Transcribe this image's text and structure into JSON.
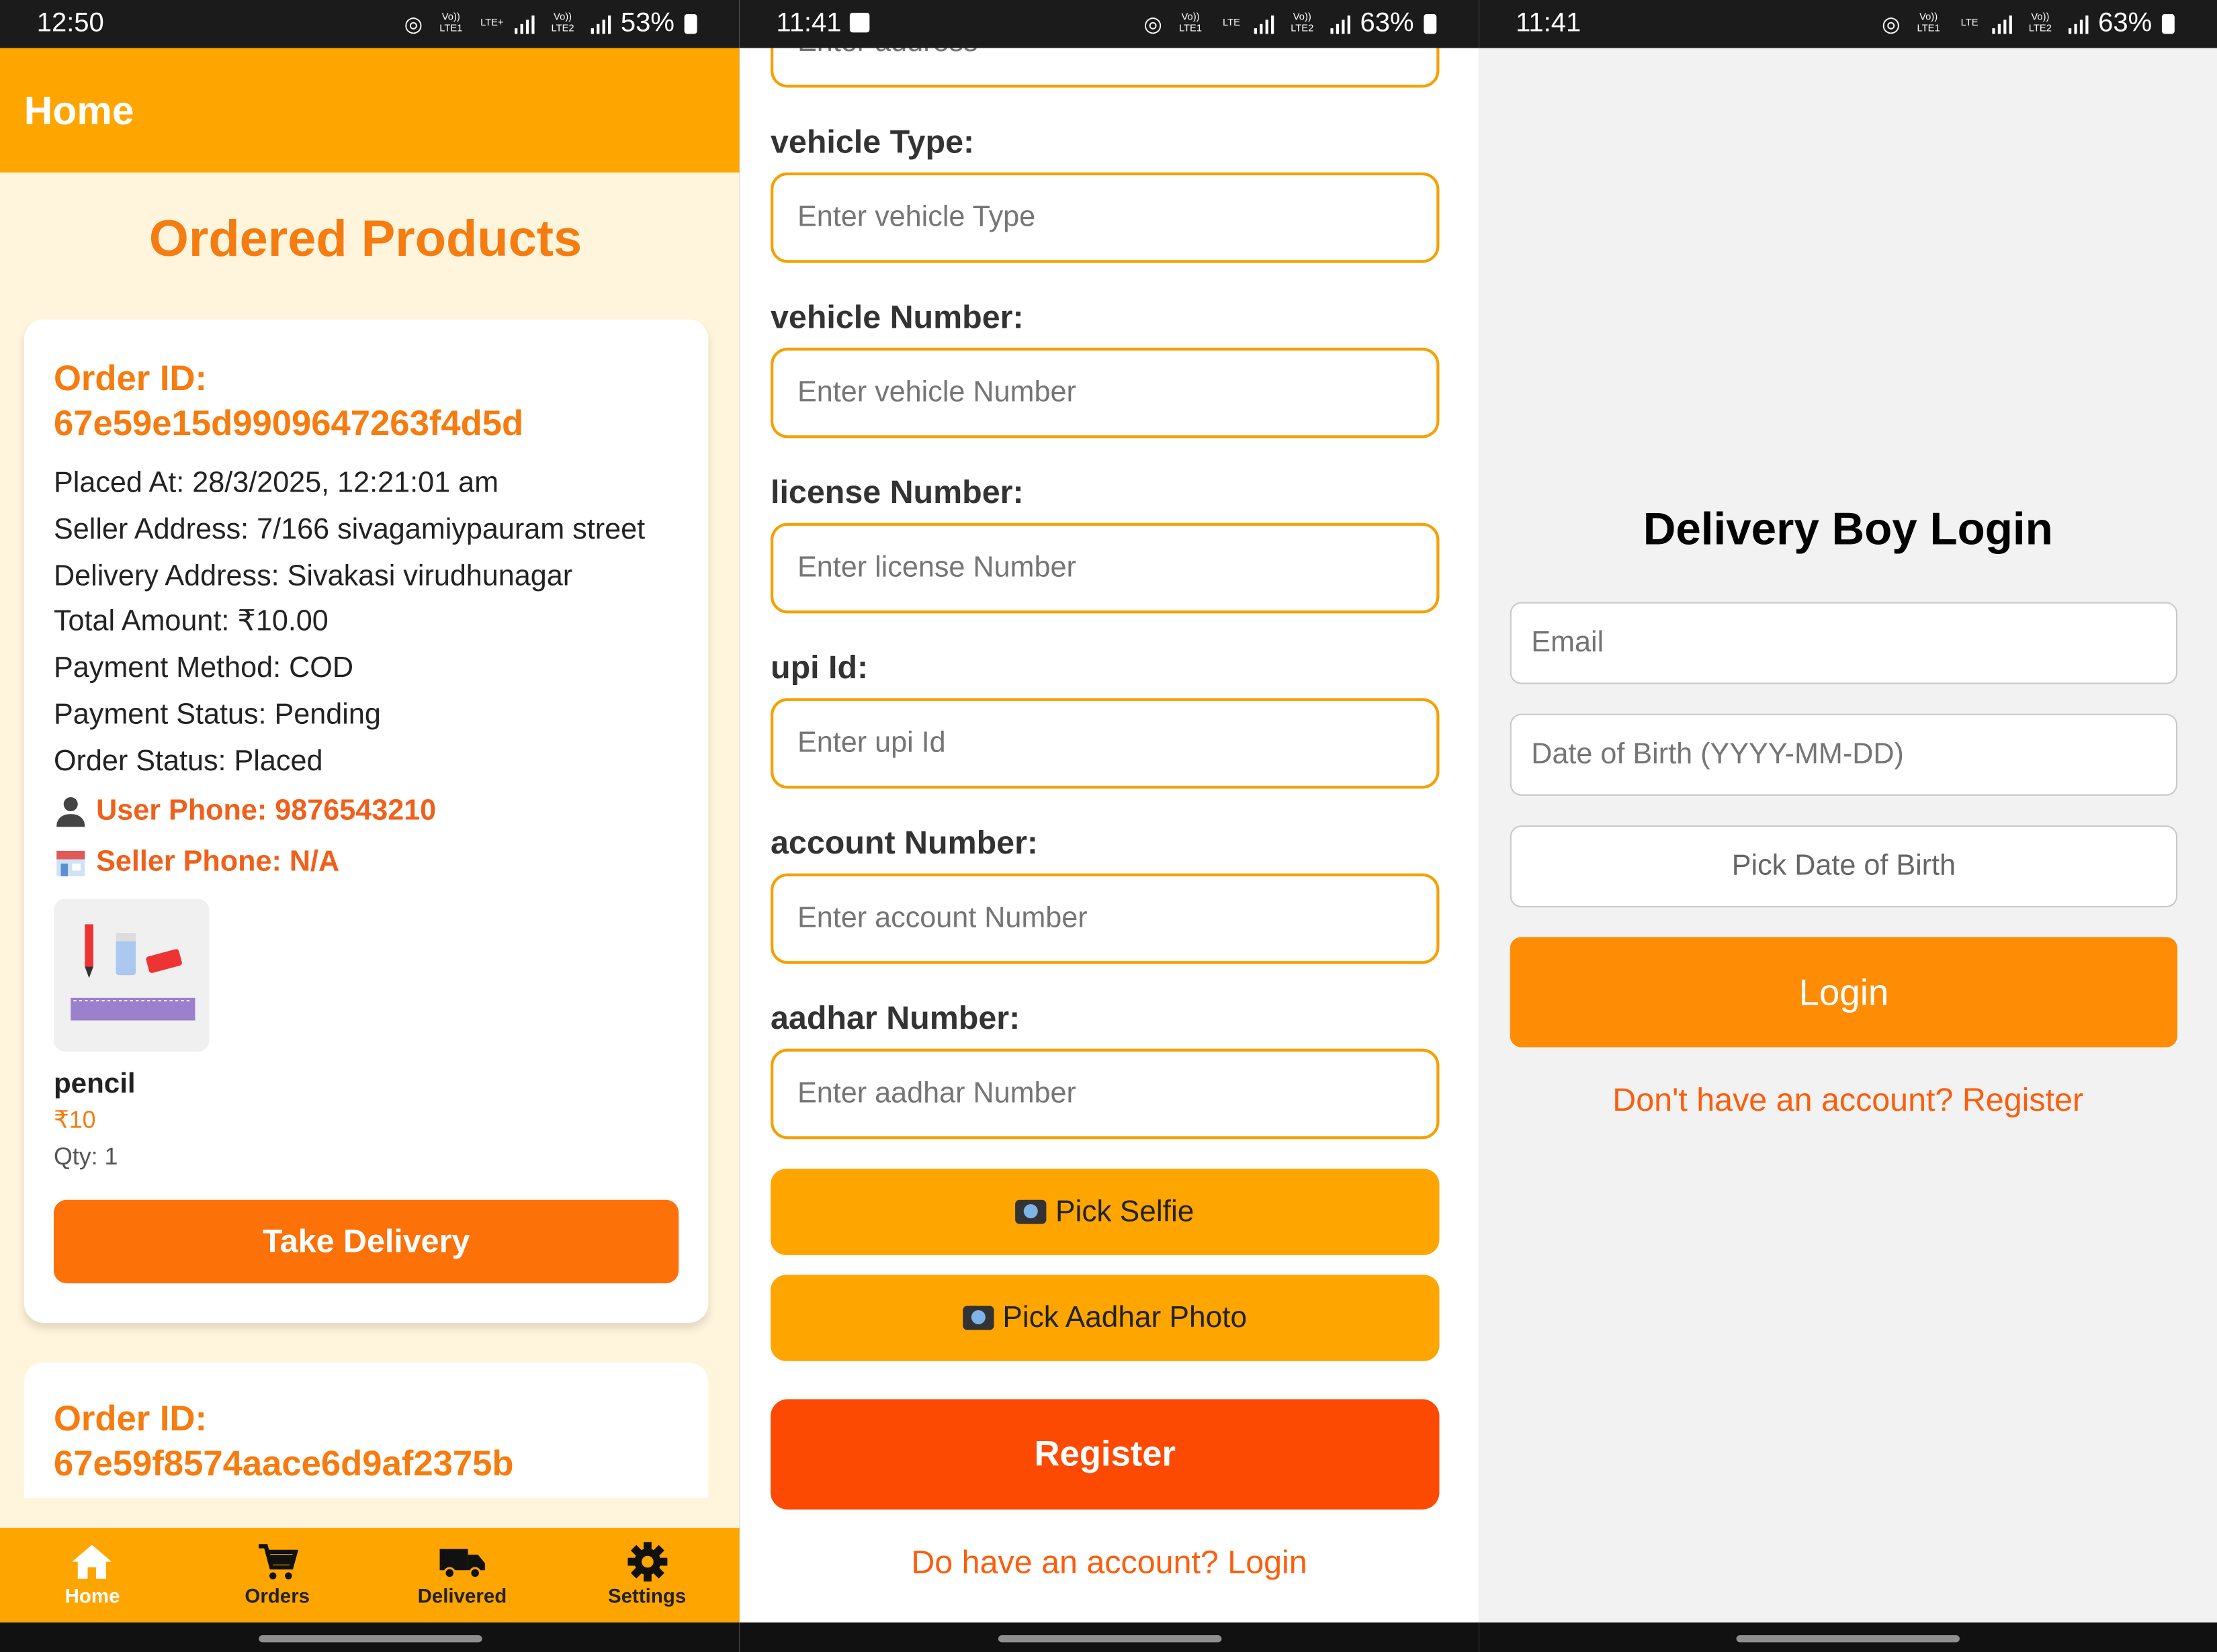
{
  "screens": {
    "home": {
      "status": {
        "time": "12:50",
        "battery": "53%",
        "net1": "Vo)) LTE1",
        "net2": "LTE+",
        "net3": "Vo)) LTE2"
      },
      "appbar_title": "Home",
      "list_title": "Ordered Products",
      "orders": [
        {
          "id_label": "Order ID:",
          "id": "67e59e15d9909647263f4d5d",
          "placed_at": "Placed At: 28/3/2025, 12:21:01 am",
          "seller_address": "Seller Address: 7/166 sivagamiypauram street",
          "delivery_address": "Delivery Address: Sivakasi virudhunagar",
          "total_amount": "Total Amount: ₹10.00",
          "payment_method": "Payment Method: COD",
          "payment_status": "Payment Status: Pending",
          "order_status": "Order Status: Placed",
          "user_phone": "User Phone: 9876543210",
          "seller_phone": "Seller Phone: N/A",
          "product": {
            "name": "pencil",
            "price": "₹10",
            "qty": "Qty: 1"
          },
          "action_label": "Take Delivery"
        },
        {
          "id_label": "Order ID:",
          "id": "67e59f8574aace6d9af2375b"
        }
      ],
      "tabs": [
        {
          "label": "Home",
          "icon": "home-icon"
        },
        {
          "label": "Orders",
          "icon": "cart-icon"
        },
        {
          "label": "Delivered",
          "icon": "truck-icon"
        },
        {
          "label": "Settings",
          "icon": "gear-icon"
        }
      ]
    },
    "register": {
      "status": {
        "time": "11:41",
        "battery": "63%",
        "net1": "Vo)) LTE1",
        "net2": "LTE",
        "net3": "Vo)) LTE2"
      },
      "top_placeholder": "Enter address",
      "fields": [
        {
          "label": "vehicle Type:",
          "placeholder": "Enter vehicle Type"
        },
        {
          "label": "vehicle Number:",
          "placeholder": "Enter vehicle Number"
        },
        {
          "label": "license Number:",
          "placeholder": "Enter license Number"
        },
        {
          "label": "upi Id:",
          "placeholder": "Enter upi Id"
        },
        {
          "label": "account Number:",
          "placeholder": "Enter account Number"
        },
        {
          "label": "aadhar Number:",
          "placeholder": "Enter aadhar Number"
        }
      ],
      "pick_selfie": "Pick Selfie",
      "pick_aadhar": "Pick Aadhar Photo",
      "register_label": "Register",
      "login_link": "Do have an account? Login"
    },
    "login": {
      "status": {
        "time": "11:41",
        "battery": "63%",
        "net1": "Vo)) LTE1",
        "net2": "LTE",
        "net3": "Vo)) LTE2"
      },
      "title": "Delivery Boy Login",
      "email_placeholder": "Email",
      "dob_placeholder": "Date of Birth (YYYY-MM-DD)",
      "pick_dob": "Pick Date of Birth",
      "login_label": "Login",
      "register_link": "Don't have an account? Register"
    }
  },
  "colors": {
    "orange": "#ffa500",
    "accent": "#f57c10",
    "register": "#fc4a03",
    "login": "#fe8c05"
  }
}
